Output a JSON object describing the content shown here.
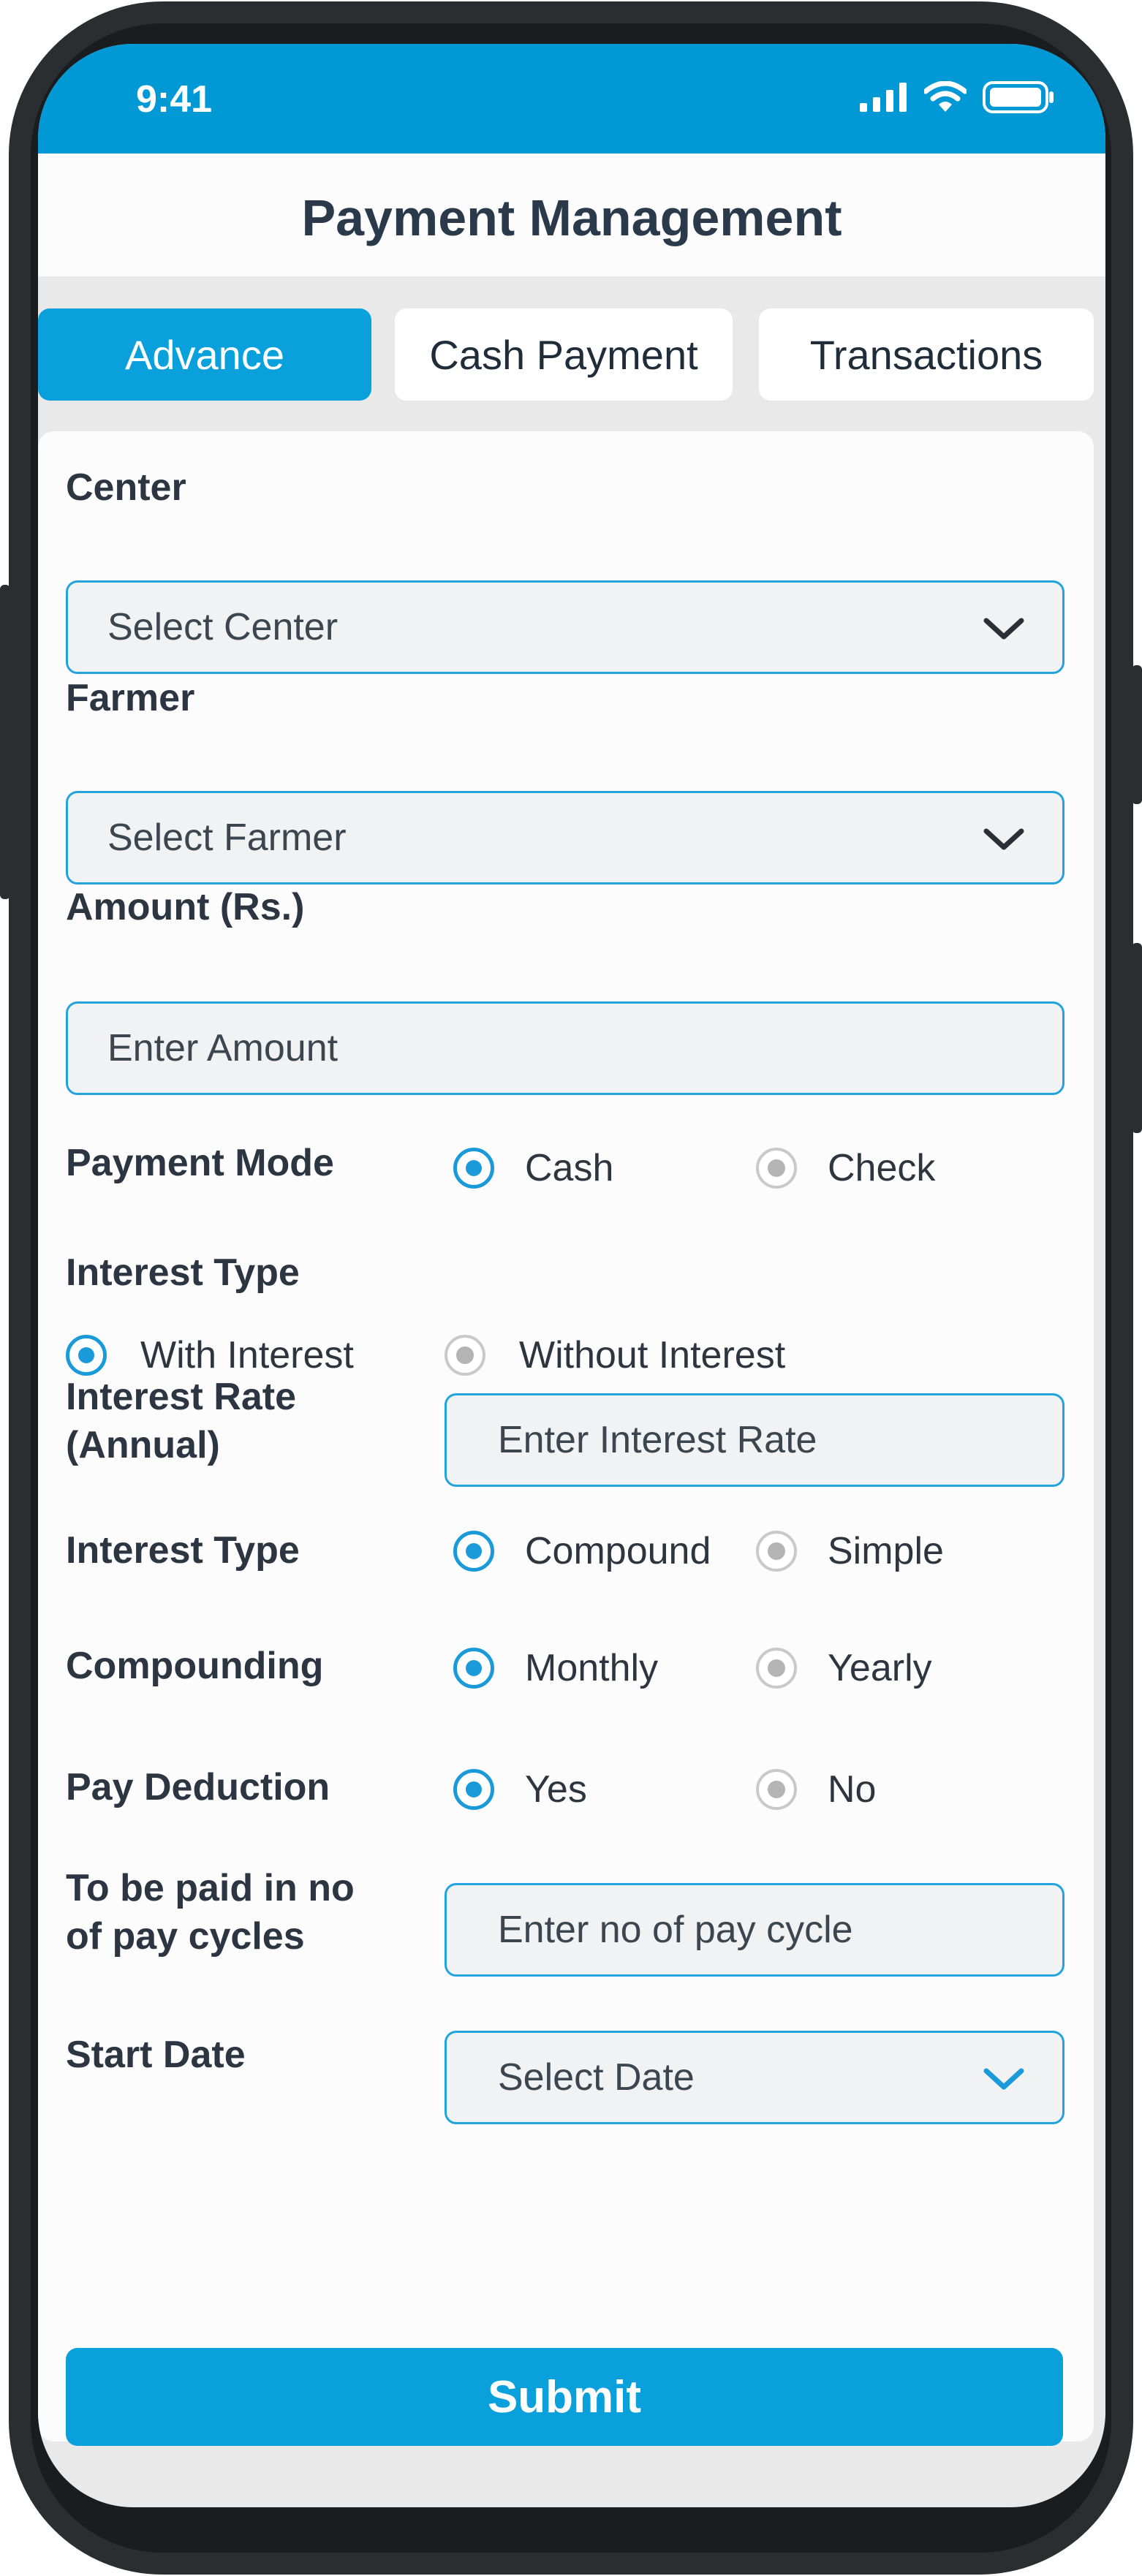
{
  "status_bar": {
    "time": "9:41",
    "icons": [
      "signal-icon",
      "wifi-icon",
      "battery-icon"
    ]
  },
  "header": {
    "title": "Payment Management"
  },
  "tabs": [
    {
      "label": "Advance",
      "active": true
    },
    {
      "label": "Cash Payment",
      "active": false
    },
    {
      "label": "Transactions",
      "active": false
    }
  ],
  "form": {
    "center": {
      "label": "Center",
      "placeholder": "Select Center"
    },
    "farmer": {
      "label": "Farmer",
      "placeholder": "Select Farmer"
    },
    "amount": {
      "label": "Amount (Rs.)",
      "placeholder": "Enter Amount"
    },
    "payment_mode": {
      "label": "Payment Mode",
      "options": [
        "Cash",
        "Check"
      ],
      "selected": "Cash"
    },
    "interest_type_1": {
      "label": "Interest Type",
      "options": [
        "With Interest",
        "Without Interest"
      ],
      "selected": "With Interest"
    },
    "interest_rate": {
      "label_line1": "Interest Rate",
      "label_line2": "(Annual)",
      "placeholder": "Enter Interest Rate"
    },
    "interest_type_2": {
      "label": "Interest Type",
      "options": [
        "Compound",
        "Simple"
      ],
      "selected": "Compound"
    },
    "compounding": {
      "label": "Compounding",
      "options": [
        "Monthly",
        "Yearly"
      ],
      "selected": "Monthly"
    },
    "pay_deduction": {
      "label": "Pay Deduction",
      "options": [
        "Yes",
        "No"
      ],
      "selected": "Yes"
    },
    "pay_cycles": {
      "label_line1": "To be paid in no",
      "label_line2": "of pay cycles",
      "placeholder": "Enter no of pay cycle"
    },
    "start_date": {
      "label": "Start Date",
      "placeholder": "Select Date"
    },
    "submit_label": "Submit"
  },
  "colors": {
    "primary": "#0aa0dc",
    "status_bar": "#0099d6",
    "text": "#2c3642"
  }
}
